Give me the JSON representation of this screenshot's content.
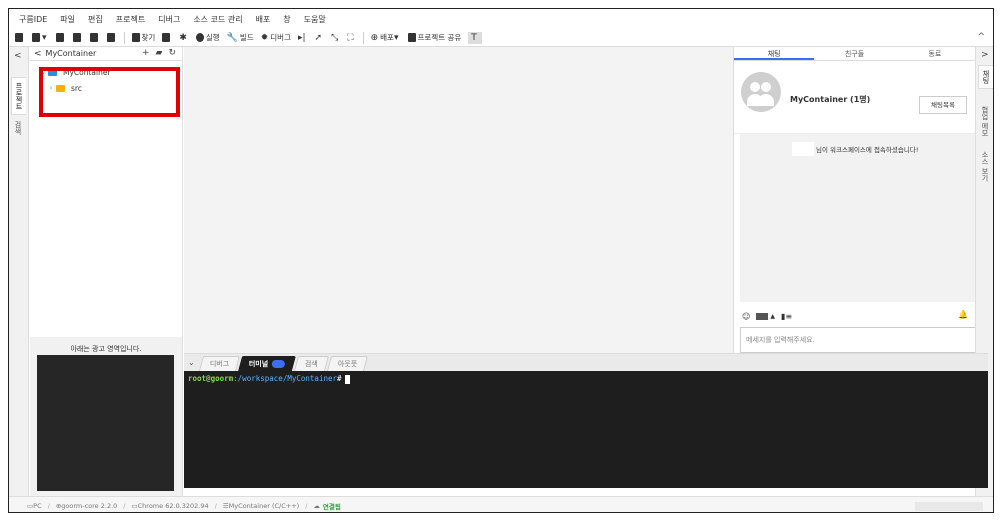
{
  "menu": [
    "구름IDE",
    "파일",
    "편집",
    "프로젝트",
    "디버그",
    "소스 코드 관리",
    "배포",
    "창",
    "도움말"
  ],
  "toolbar": {
    "find": "찾기",
    "run": "실행",
    "build": "빌드",
    "debug": "디버그",
    "deploy": "배포",
    "share": "프로젝트 공유"
  },
  "left_tabs": [
    "프로젝트",
    "검색"
  ],
  "project_panel": {
    "title": "MyContainer",
    "tree": [
      {
        "label": "MyContainer",
        "color": "#2b8fe0"
      },
      {
        "label": "src",
        "color": "#f5b301"
      }
    ],
    "ad_label": "아래는 광고 영역입니다."
  },
  "chat": {
    "tabs": [
      "채팅",
      "친구들",
      "동료"
    ],
    "title": "MyContainer (1명)",
    "list_button": "채팅목록",
    "notice": "님이 워크스페이스에 접속하셨습니다!",
    "input_placeholder": "메세지를 입력해주세요."
  },
  "right_tabs": [
    "채팅",
    "협업 메모",
    "소스 보기"
  ],
  "bottom": {
    "tabs": [
      "디버그",
      "터미널",
      "검색",
      "아웃풋"
    ],
    "active_tab": "터미널"
  },
  "terminal": {
    "user": "root@goorm",
    "path": ":/workspace/MyContainer",
    "hash": "#"
  },
  "status": {
    "pc": "PC",
    "core": "goorm-core 2.2.0",
    "browser": "Chrome 62.0.3202.94",
    "project": "MyContainer (C/C++)",
    "connection": "연결됨"
  },
  "colors": {
    "highlight": "#e00000",
    "accent": "#3d6ef0",
    "terminal_bg": "#1e1e1e"
  }
}
